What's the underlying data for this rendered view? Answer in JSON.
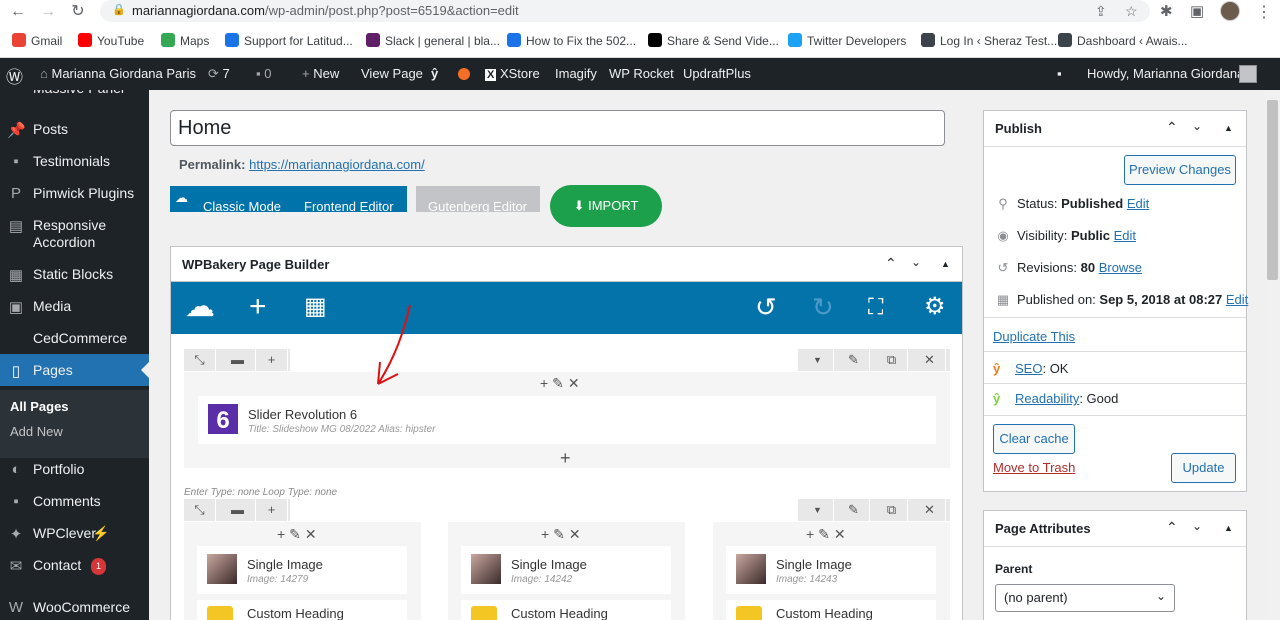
{
  "browser": {
    "url_host": "mariannagiordana.com",
    "url_path": "/wp-admin/post.php?post=6519&action=edit",
    "bookmarks": [
      {
        "label": "Gmail",
        "color": "#ea4335",
        "icon": "gmail-icon"
      },
      {
        "label": "YouTube",
        "color": "#ff0000",
        "icon": "youtube-icon"
      },
      {
        "label": "Maps",
        "color": "#34a853",
        "icon": "maps-icon"
      },
      {
        "label": "Support for Latitud...",
        "color": "#1a73e8",
        "icon": "support-icon"
      },
      {
        "label": "Slack | general | bla...",
        "color": "#611f69",
        "icon": "slack-icon"
      },
      {
        "label": "How to Fix the 502...",
        "color": "#1a73e8",
        "icon": "globe-icon"
      },
      {
        "label": "Share & Send Vide...",
        "color": "#000000",
        "icon": "vimeo-icon"
      },
      {
        "label": "Twitter Developers",
        "color": "#1da1f2",
        "icon": "twitter-icon"
      },
      {
        "label": "Log In ‹ Sheraz Test...",
        "color": "#3c434a",
        "icon": "wordpress-icon"
      },
      {
        "label": "Dashboard ‹ Awais...",
        "color": "#3c434a",
        "icon": "wordpress-icon"
      }
    ]
  },
  "adminbar": {
    "site_name": "Marianna Giordana Paris",
    "updates_count": "7",
    "comments_count": "0",
    "new_label": "New",
    "view_page": "View Page",
    "xstore": "XStore",
    "imagify": "Imagify",
    "wp_rocket": "WP Rocket",
    "updraft": "UpdraftPlus",
    "howdy": "Howdy, Marianna Giordana"
  },
  "sidebar": {
    "partial_top": "Massive Panel",
    "items": [
      {
        "label": "Posts",
        "icon": "pin-icon"
      },
      {
        "label": "Testimonials",
        "icon": "comment-icon"
      },
      {
        "label": "Pimwick Plugins",
        "icon": "pw-icon"
      },
      {
        "label": "Responsive Accordion",
        "icon": "accordion-icon"
      },
      {
        "label": "Static Blocks",
        "icon": "blocks-icon"
      },
      {
        "label": "Media",
        "icon": "media-icon"
      },
      {
        "label": "CedCommerce",
        "icon": ""
      },
      {
        "label": "Pages",
        "icon": "pages-icon"
      },
      {
        "label": "Portfolio",
        "icon": "portfolio-icon"
      },
      {
        "label": "Comments",
        "icon": "comment-icon"
      },
      {
        "label": "WPClever",
        "icon": "bulb-icon"
      },
      {
        "label": "Contact",
        "icon": "mail-icon"
      },
      {
        "label": "WooCommerce",
        "icon": "woo-icon"
      }
    ],
    "contact_badge": "1",
    "submenu": [
      "All Pages",
      "Add New"
    ]
  },
  "editor": {
    "title_value": "Home",
    "permalink_label": "Permalink:",
    "permalink_url": "https://mariannagiordana.com/",
    "classic_mode": "Classic Mode",
    "frontend_editor": "Frontend Editor",
    "gutenberg_editor": "Gutenberg Editor",
    "import_label": "IMPORT"
  },
  "wpbakery": {
    "title": "WPBakery Page Builder",
    "row1_element": {
      "name": "Slider Revolution 6",
      "meta": "Title: Slideshow MG 08/2022  Alias: hipster"
    },
    "row2_info": "Enter Type: none  Loop Type: none",
    "columns": [
      {
        "name": "Single Image",
        "meta": "Image: 14279",
        "heading": "Custom Heading"
      },
      {
        "name": "Single Image",
        "meta": "Image: 14242",
        "heading": "Custom Heading"
      },
      {
        "name": "Single Image",
        "meta": "Image: 14243",
        "heading": "Custom Heading"
      }
    ]
  },
  "publish": {
    "title": "Publish",
    "preview": "Preview Changes",
    "status_label": "Status:",
    "status_value": "Published",
    "edit": "Edit",
    "visibility_label": "Visibility:",
    "visibility_value": "Public",
    "revisions_label": "Revisions:",
    "revisions_value": "80",
    "browse": "Browse",
    "published_label": "Published on:",
    "published_value": "Sep 5, 2018 at 08:27",
    "duplicate": "Duplicate This",
    "seo_label": "SEO",
    "seo_value": ": OK",
    "readability_label": "Readability",
    "readability_value": ": Good",
    "clear_cache": "Clear cache",
    "trash": "Move to Trash",
    "update": "Update"
  },
  "page_attributes": {
    "title": "Page Attributes",
    "parent_label": "Parent",
    "parent_value": "(no parent)"
  },
  "colors": {
    "wp_blue": "#2271b1",
    "wpb_blue": "#0473aa",
    "import_green": "#1ca04b",
    "admin_dark": "#1d2327"
  }
}
